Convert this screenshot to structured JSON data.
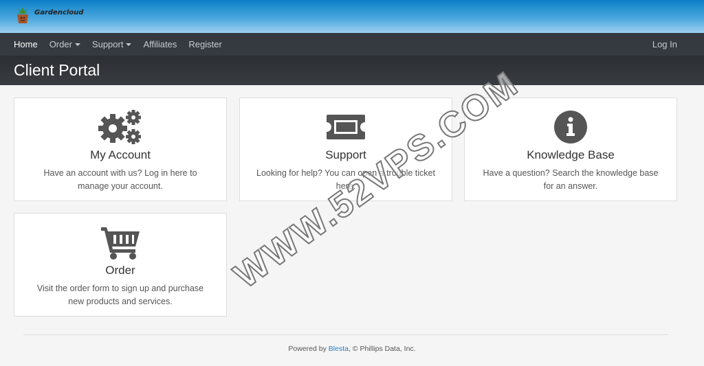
{
  "brand": {
    "name": "Gardencloud",
    "logo_icon": "flower-pot-icon"
  },
  "nav": {
    "items": [
      {
        "label": "Home",
        "active": true,
        "dropdown": false
      },
      {
        "label": "Order",
        "active": false,
        "dropdown": true
      },
      {
        "label": "Support",
        "active": false,
        "dropdown": true
      },
      {
        "label": "Affiliates",
        "active": false,
        "dropdown": false
      },
      {
        "label": "Register",
        "active": false,
        "dropdown": false
      }
    ],
    "login_label": "Log In"
  },
  "header": {
    "title": "Client Portal"
  },
  "cards": [
    {
      "icon": "gears-icon",
      "title": "My Account",
      "description": "Have an account with us? Log in here to manage your account."
    },
    {
      "icon": "ticket-icon",
      "title": "Support",
      "description": "Looking for help? You can open a trouble ticket here."
    },
    {
      "icon": "info-circle-icon",
      "title": "Knowledge Base",
      "description": "Have a question? Search the knowledge base for an answer."
    },
    {
      "icon": "shopping-cart-icon",
      "title": "Order",
      "description": "Visit the order form to sign up and purchase new products and services."
    }
  ],
  "footer": {
    "prefix": "Powered by ",
    "link": "Blesta",
    "suffix": ", © Phillips Data, Inc."
  },
  "watermark": "WWW.52VPS.COM"
}
